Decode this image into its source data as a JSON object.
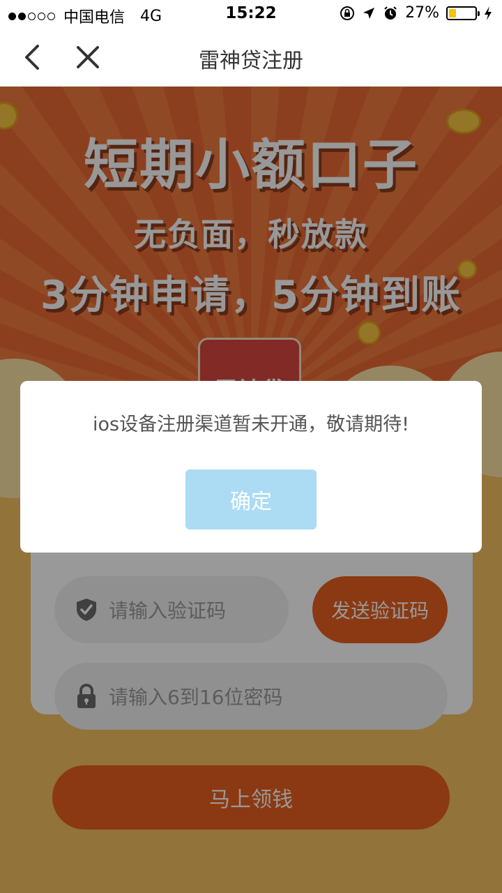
{
  "status_bar": {
    "carrier": "中国电信",
    "network": "4G",
    "time": "15:22",
    "battery": "27%",
    "battery_level": 0.27
  },
  "nav": {
    "title": "雷神贷注册",
    "back_icon": "chevron-left-icon",
    "close_icon": "close-icon"
  },
  "banner": {
    "headline": "短期小额口子",
    "line2": "无负面，秒放款",
    "line3": "3分钟申请，5分钟到账",
    "logo_text": "雷神贷"
  },
  "form": {
    "code_placeholder": "请输入验证码",
    "send_code_label": "发送验证码",
    "password_placeholder": "请输入6到16位密码",
    "submit_label": "马上领钱",
    "shield_icon": "shield-check-icon",
    "lock_icon": "lock-icon"
  },
  "dialog": {
    "message": "ios设备注册渠道暂未开通，敬请期待!",
    "confirm_label": "确定"
  },
  "colors": {
    "accent": "#e8601f",
    "banner": "#ea6a35",
    "background": "#f3c062",
    "dialog_button": "#abdcf3"
  }
}
